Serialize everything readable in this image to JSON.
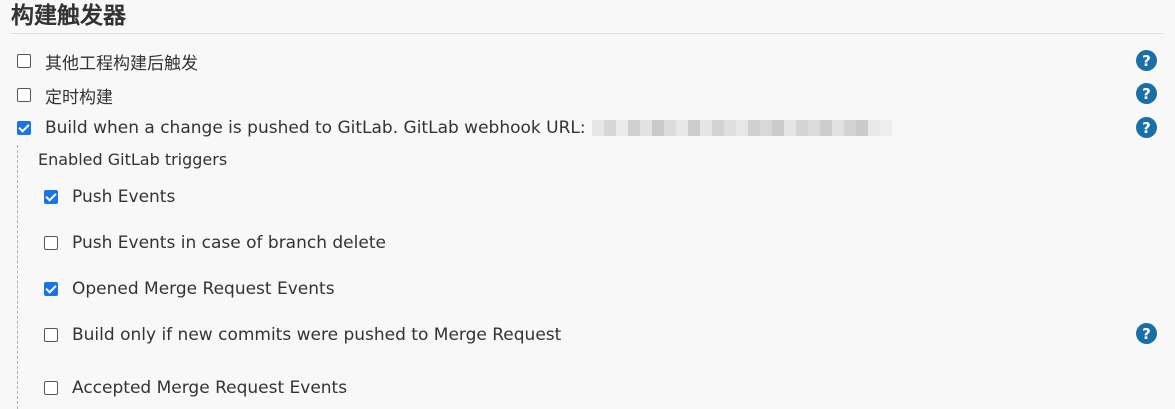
{
  "section": {
    "title": "构建触发器"
  },
  "triggers": [
    {
      "label": "其他工程构建后触发",
      "checked": false
    },
    {
      "label": "定时构建",
      "checked": false
    },
    {
      "label": "Build when a change is pushed to GitLab. GitLab webhook URL:",
      "checked": true
    }
  ],
  "gitlab": {
    "subheading": "Enabled GitLab triggers",
    "options": [
      {
        "label": "Push Events",
        "checked": true
      },
      {
        "label": "Push Events in case of branch delete",
        "checked": false
      },
      {
        "label": "Opened Merge Request Events",
        "checked": true
      },
      {
        "label": "Build only if new commits were pushed to Merge Request",
        "checked": false
      },
      {
        "label": "Accepted Merge Request Events",
        "checked": false
      }
    ]
  },
  "help": {
    "glyph": "?",
    "icon": "help-icon"
  },
  "colors": {
    "accent": "#1a73e8",
    "help": "#1a6fa8"
  }
}
